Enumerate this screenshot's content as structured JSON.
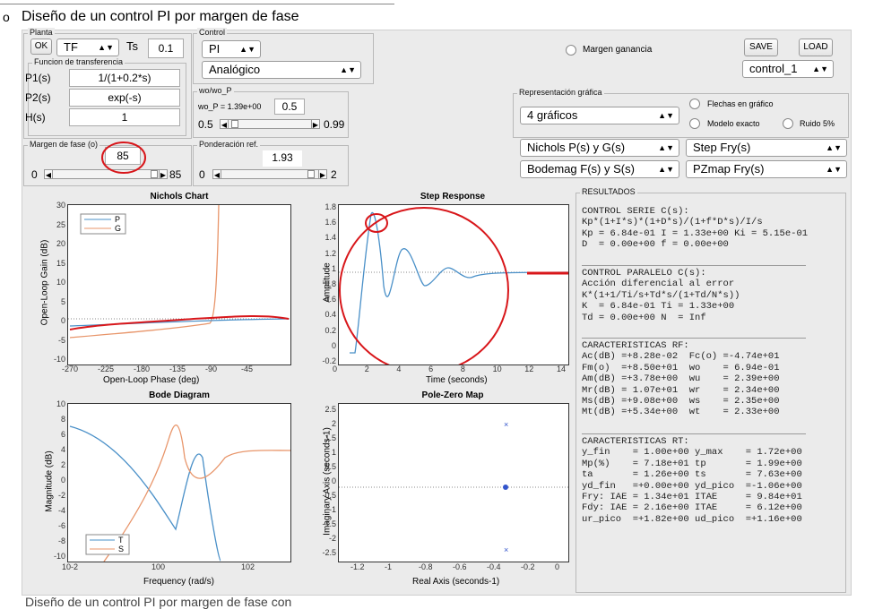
{
  "doc": {
    "bullet": "o",
    "title": "Diseño de un control PI por margen de fase",
    "bottom_text": "Diseño de un control PI por margen de fase con"
  },
  "planta": {
    "title": "Planta",
    "ok_label": "OK",
    "model": "TF",
    "ts_label": "Ts",
    "ts_value": "0.1",
    "ft_title": "Funcion de transferencia",
    "rows": [
      {
        "label": "P1(s)",
        "value": "1/(1+0.2*s)"
      },
      {
        "label": "P2(s)",
        "value": "exp(-s)"
      },
      {
        "label": "H(s)",
        "value": "1"
      }
    ]
  },
  "control": {
    "title": "Control",
    "type": "PI",
    "mode": "Analógico"
  },
  "wo": {
    "title": "wo/wo_P",
    "label": "wo_P = 1.39e+00",
    "value": "0.5",
    "min": "0.5",
    "max": "0.99",
    "level": 0.02
  },
  "margen": {
    "title": "Margen de fase (o)",
    "value": "85",
    "min": "0",
    "max": "85",
    "level": 1.0
  },
  "ponderacion": {
    "title": "Ponderación ref.",
    "value": "1.93",
    "min": "0",
    "max": "2",
    "level": 0.965
  },
  "top_right": {
    "margen_ganancia": "Margen ganancia",
    "save": "SAVE",
    "load": "LOAD",
    "config": "control_1"
  },
  "representacion": {
    "title": "Representación gráfica",
    "graficos": "4 gráficos",
    "flechas": "Flechas en gráfico",
    "modelo": "Modelo exacto",
    "ruido": "Ruido 5%",
    "plot_selects": [
      "Nichols P(s) y G(s)",
      "Step Fry(s)",
      "Bodemag F(s) y S(s)",
      "PZmap Fry(s)"
    ]
  },
  "plots": {
    "nichols": {
      "title": "Nichols Chart",
      "xlabel": "Open-Loop Phase (deg)",
      "ylabel": "Open-Loop Gain (dB)",
      "xticks": [
        "-270",
        "-225",
        "-180",
        "-135",
        "-90",
        "-45"
      ],
      "yticks": [
        "30",
        "25",
        "20",
        "15",
        "10",
        "5",
        "0",
        "-5",
        "-10"
      ],
      "legend": [
        "P",
        "G"
      ]
    },
    "step": {
      "title": "Step Response",
      "xlabel": "Time (seconds)",
      "ylabel": "Amplitude",
      "xticks": [
        "0",
        "2",
        "4",
        "6",
        "8",
        "10",
        "12",
        "14"
      ],
      "yticks": [
        "1.8",
        "1.6",
        "1.4",
        "1.2",
        "1",
        "0.8",
        "0.6",
        "0.4",
        "0.2",
        "0",
        "-0.2"
      ]
    },
    "bode": {
      "title": "Bode Diagram",
      "xlabel": "Frequency  (rad/s)",
      "ylabel": "Magnitude (dB)",
      "xticks": [
        "10-2",
        "100",
        "102"
      ],
      "yticks": [
        "10",
        "8",
        "6",
        "4",
        "2",
        "0",
        "-2",
        "-4",
        "-6",
        "-8",
        "-10"
      ],
      "legend": [
        "T",
        "S"
      ]
    },
    "pz": {
      "title": "Pole-Zero Map",
      "xlabel": "Real Axis (seconds-1)",
      "ylabel": "Imaginary Axis (seconds-1)",
      "xticks": [
        "-1.2",
        "-1",
        "-0.8",
        "-0.6",
        "-0.4",
        "-0.2",
        "0"
      ],
      "yticks": [
        "2.5",
        "2",
        "1.5",
        "1",
        "0.5",
        "0",
        "-0.5",
        "-1",
        "-1.5",
        "-2",
        "-2.5"
      ]
    }
  },
  "results": {
    "title": "RESULTADOS",
    "serie": "CONTROL SERIE C(s):\nKp*(1+I*s)*(1+D*s)/(1+f*D*s)/I/s\nKp = 6.84e-01 I = 1.33e+00 Ki = 5.15e-01\nD  = 0.00e+00 f = 0.00e+00",
    "paralelo": "CONTROL PARALELO C(s):\nAcción diferencial al error\nK*(1+1/Ti/s+Td*s/(1+Td/N*s))\nK  = 6.84e-01 Ti = 1.33e+00\nTd = 0.00e+00 N  = Inf",
    "rf": "CARACTERISTICAS RF:\nAc(dB) =+8.28e-02  Fc(o) =-4.74e+01\nFm(o)  =+8.50e+01  wo    = 6.94e-01\nAm(dB) =+3.78e+00  wu    = 2.39e+00\nMr(dB) = 1.07e+01  wr    = 2.34e+00\nMs(dB) =+9.08e+00  ws    = 2.35e+00\nMt(dB) =+5.34e+00  wt    = 2.33e+00",
    "rt": "CARACTERISTICAS RT:\ny_fin    = 1.00e+00 y_max    = 1.72e+00\nMp(%)    = 7.18e+01 tp       = 1.99e+00\nta       = 1.26e+00 ts       = 7.63e+00\nyd_fin   =+0.00e+00 yd_pico  =-1.06e+00\nFry: IAE = 1.34e+01 ITAE     = 9.84e+01\nFdy: IAE = 2.16e+00 ITAE     = 6.12e+00\nur_pico  =+1.82e+00 ud_pico  =+1.16e+00"
  },
  "colors": {
    "series_blue": "#4a90c8",
    "series_orange": "#e8956a",
    "annotation_red": "#d8161a",
    "panel_bg": "#ebebeb"
  }
}
